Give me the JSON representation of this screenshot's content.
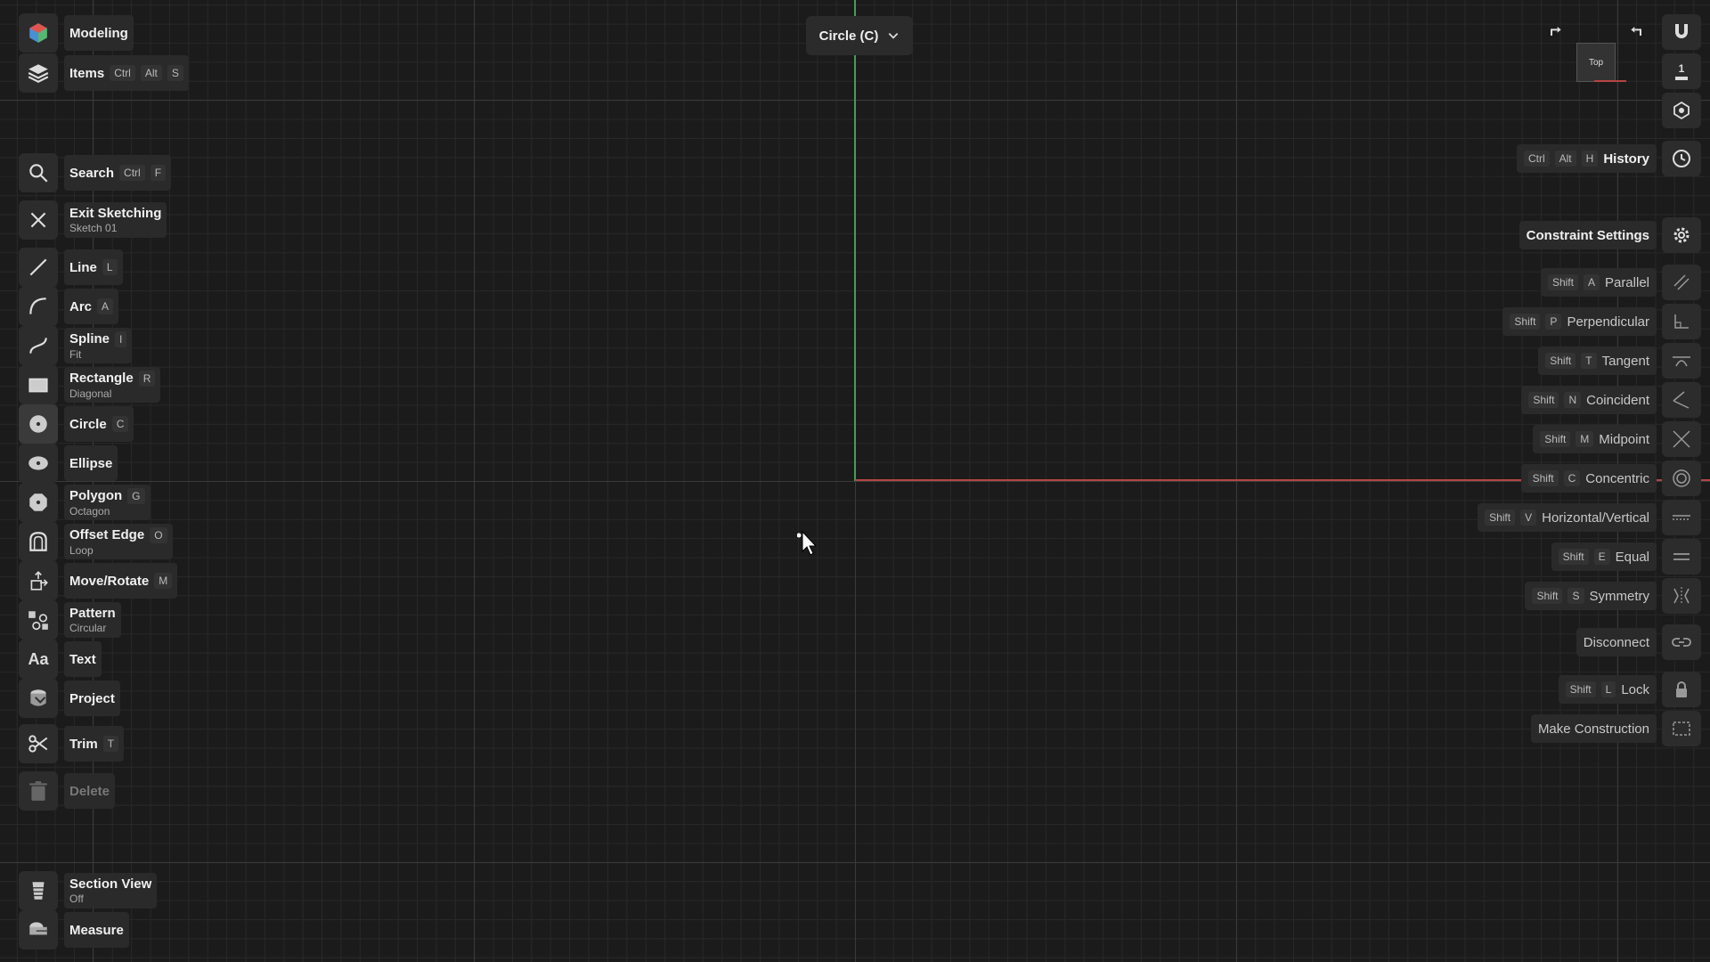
{
  "top": {
    "workspace": "Modeling",
    "items": "Items",
    "items_keys": [
      "Ctrl",
      "Alt",
      "S"
    ]
  },
  "tool_dropdown": {
    "label": "Circle (C)"
  },
  "left_tools": [
    {
      "name": "Search",
      "keys": [
        "Ctrl",
        "F"
      ]
    },
    {
      "name": "Exit Sketching",
      "sub": "Sketch 01"
    },
    {
      "name": "Line",
      "keys": [
        "L"
      ]
    },
    {
      "name": "Arc",
      "keys": [
        "A"
      ]
    },
    {
      "name": "Spline",
      "sub": "Fit",
      "keys": [
        "I"
      ]
    },
    {
      "name": "Rectangle",
      "sub": "Diagonal",
      "keys": [
        "R"
      ]
    },
    {
      "name": "Circle",
      "keys": [
        "C"
      ]
    },
    {
      "name": "Ellipse"
    },
    {
      "name": "Polygon",
      "sub": "Octagon",
      "keys": [
        "G"
      ]
    },
    {
      "name": "Offset Edge",
      "sub": "Loop",
      "keys": [
        "O"
      ]
    },
    {
      "name": "Move/Rotate",
      "keys": [
        "M"
      ]
    },
    {
      "name": "Pattern",
      "sub": "Circular"
    },
    {
      "name": "Text"
    },
    {
      "name": "Project"
    },
    {
      "name": "Trim",
      "keys": [
        "T"
      ]
    },
    {
      "name": "Delete"
    }
  ],
  "bottom_tools": [
    {
      "name": "Section View",
      "sub": "Off"
    },
    {
      "name": "Measure"
    }
  ],
  "viewcube": {
    "label": "Top"
  },
  "right_panel": {
    "history": {
      "name": "History",
      "keys": [
        "Ctrl",
        "Alt",
        "H"
      ]
    },
    "constraint_settings": "Constraint Settings",
    "constraints": [
      {
        "name": "Parallel",
        "keys": [
          "Shift",
          "A"
        ]
      },
      {
        "name": "Perpendicular",
        "keys": [
          "Shift",
          "P"
        ]
      },
      {
        "name": "Tangent",
        "keys": [
          "Shift",
          "T"
        ]
      },
      {
        "name": "Coincident",
        "keys": [
          "Shift",
          "N"
        ]
      },
      {
        "name": "Midpoint",
        "keys": [
          "Shift",
          "M"
        ]
      },
      {
        "name": "Concentric",
        "keys": [
          "Shift",
          "C"
        ]
      },
      {
        "name": "Horizontal/Vertical",
        "keys": [
          "Shift",
          "V"
        ]
      },
      {
        "name": "Equal",
        "keys": [
          "Shift",
          "E"
        ]
      },
      {
        "name": "Symmetry",
        "keys": [
          "Shift",
          "S"
        ]
      }
    ],
    "disconnect": "Disconnect",
    "lock": {
      "name": "Lock",
      "keys": [
        "Shift",
        "L"
      ]
    },
    "make_construction": "Make Construction",
    "zoom": "1"
  }
}
